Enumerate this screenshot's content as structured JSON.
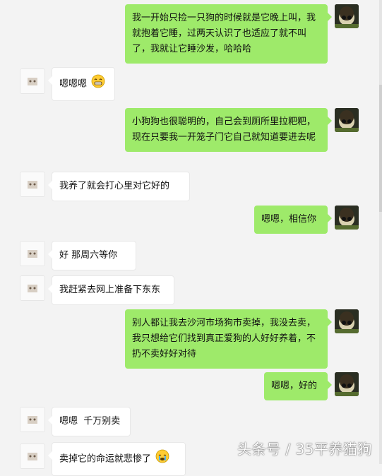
{
  "messages": [
    {
      "side": "me",
      "text": "我一开始只捡一只狗的时候就是它晚上叫，我就抱着它睡，过两天认识了也适应了就不叫了，我就让它睡沙发，哈哈哈"
    },
    {
      "side": "other",
      "text": "嗯嗯嗯",
      "emoji": "grin-emoji"
    },
    {
      "side": "me",
      "text": "小狗狗也很聪明的，自己会到厕所里拉粑粑，现在只要我一开笼子门它自己就知道要进去呢"
    },
    {
      "side": "other",
      "text": "我养了就会打心里对它好的"
    },
    {
      "side": "me",
      "text": "嗯嗯，相信你"
    },
    {
      "side": "other",
      "text": "好 那周六等你"
    },
    {
      "side": "other",
      "text": "我赶紧去网上准备下东东"
    },
    {
      "side": "me",
      "text": "别人都让我去沙河市场狗市卖掉，我没去卖，我只想给它们找到真正爱狗的人好好养着，不扔不卖好好对待"
    },
    {
      "side": "me",
      "text": "嗯嗯，好的"
    },
    {
      "side": "other",
      "text": "嗯嗯  千万别卖"
    },
    {
      "side": "other",
      "text": "卖掉它的命运就悲惨了",
      "emoji": "crying-emoji"
    }
  ],
  "watermark": "头条号 / 35平养猫狗",
  "colors": {
    "my_bubble": "#9eea6a",
    "other_bubble": "#ffffff",
    "background": "#f3f3f3"
  }
}
